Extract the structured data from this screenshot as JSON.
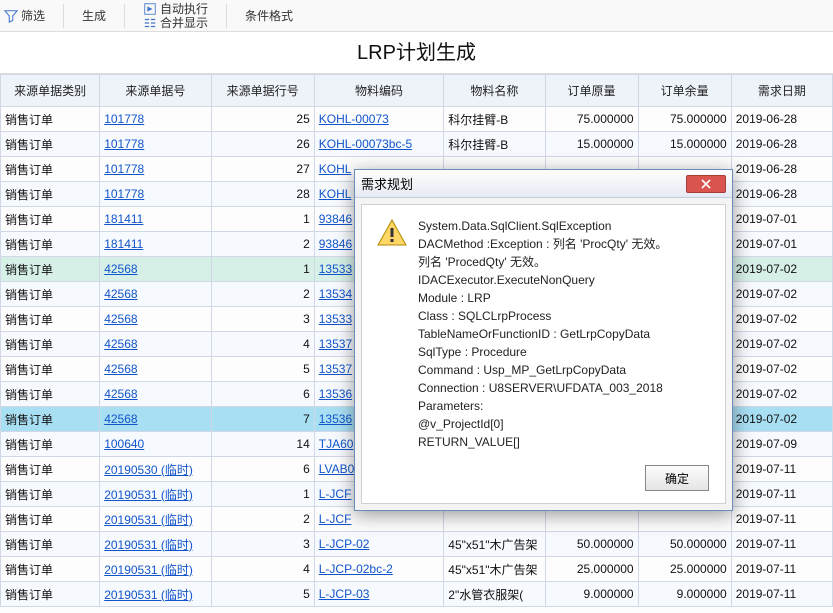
{
  "toolbar": {
    "filter": "筛选",
    "generate": "生成",
    "autorun": "自动执行",
    "merge_display": "合并显示",
    "cond_format": "条件格式"
  },
  "title": "LRP计划生成",
  "columns": [
    "来源单据类别",
    "来源单据号",
    "来源单据行号",
    "物料编码",
    "物料名称",
    "订单原量",
    "订单余量",
    "需求日期"
  ],
  "rows": [
    {
      "type": "销售订单",
      "doc": "101778",
      "ln": "25",
      "mat": "KOHL-00073",
      "name": "科尔挂臂-B",
      "oq": "75.000000",
      "rq": "75.000000",
      "dt": "2019-06-28",
      "cls": ""
    },
    {
      "type": "销售订单",
      "doc": "101778",
      "ln": "26",
      "mat": "KOHL-00073bc-5",
      "name": "科尔挂臂-B",
      "oq": "15.000000",
      "rq": "15.000000",
      "dt": "2019-06-28",
      "cls": "alt"
    },
    {
      "type": "销售订单",
      "doc": "101778",
      "ln": "27",
      "mat": "KOHL",
      "name": "",
      "oq": "",
      "rq": "",
      "dt": "2019-06-28",
      "cls": ""
    },
    {
      "type": "销售订单",
      "doc": "101778",
      "ln": "28",
      "mat": "KOHL",
      "name": "",
      "oq": "",
      "rq": "",
      "dt": "2019-06-28",
      "cls": "alt"
    },
    {
      "type": "销售订单",
      "doc": "181411",
      "ln": "1",
      "mat": "93846",
      "name": "",
      "oq": "",
      "rq": "",
      "dt": "2019-07-01",
      "cls": ""
    },
    {
      "type": "销售订单",
      "doc": "181411",
      "ln": "2",
      "mat": "93846",
      "name": "",
      "oq": "",
      "rq": "",
      "dt": "2019-07-01",
      "cls": "alt"
    },
    {
      "type": "销售订单",
      "doc": "42568",
      "ln": "1",
      "mat": "13533",
      "name": "",
      "oq": "",
      "rq": "",
      "dt": "2019-07-02",
      "cls": "hl"
    },
    {
      "type": "销售订单",
      "doc": "42568",
      "ln": "2",
      "mat": "13534",
      "name": "",
      "oq": "",
      "rq": "",
      "dt": "2019-07-02",
      "cls": "alt"
    },
    {
      "type": "销售订单",
      "doc": "42568",
      "ln": "3",
      "mat": "13533",
      "name": "",
      "oq": "",
      "rq": "",
      "dt": "2019-07-02",
      "cls": ""
    },
    {
      "type": "销售订单",
      "doc": "42568",
      "ln": "4",
      "mat": "13537",
      "name": "",
      "oq": "",
      "rq": "",
      "dt": "2019-07-02",
      "cls": "alt"
    },
    {
      "type": "销售订单",
      "doc": "42568",
      "ln": "5",
      "mat": "13537",
      "name": "",
      "oq": "",
      "rq": "",
      "dt": "2019-07-02",
      "cls": ""
    },
    {
      "type": "销售订单",
      "doc": "42568",
      "ln": "6",
      "mat": "13536",
      "name": "",
      "oq": "",
      "rq": "",
      "dt": "2019-07-02",
      "cls": "alt"
    },
    {
      "type": "销售订单",
      "doc": "42568",
      "ln": "7",
      "mat": "13536",
      "name": "",
      "oq": "",
      "rq": "",
      "dt": "2019-07-02",
      "cls": "sel"
    },
    {
      "type": "销售订单",
      "doc": "100640",
      "ln": "14",
      "mat": "TJA60",
      "name": "",
      "oq": "",
      "rq": "",
      "dt": "2019-07-09",
      "cls": "alt"
    },
    {
      "type": "销售订单",
      "doc": "20190530 (临时)",
      "ln": "6",
      "mat": "LVAB0",
      "name": "",
      "oq": "",
      "rq": "",
      "dt": "2019-07-11",
      "cls": ""
    },
    {
      "type": "销售订单",
      "doc": "20190531 (临时)",
      "ln": "1",
      "mat": "L-JCF",
      "name": "",
      "oq": "",
      "rq": "",
      "dt": "2019-07-11",
      "cls": "alt"
    },
    {
      "type": "销售订单",
      "doc": "20190531 (临时)",
      "ln": "2",
      "mat": "L-JCF",
      "name": "",
      "oq": "",
      "rq": "",
      "dt": "2019-07-11",
      "cls": ""
    },
    {
      "type": "销售订单",
      "doc": "20190531 (临时)",
      "ln": "3",
      "mat": "L-JCP-02",
      "name": "45\"x51\"木广告架",
      "oq": "50.000000",
      "rq": "50.000000",
      "dt": "2019-07-11",
      "cls": "alt"
    },
    {
      "type": "销售订单",
      "doc": "20190531 (临时)",
      "ln": "4",
      "mat": "L-JCP-02bc-2",
      "name": "45\"x51\"木广告架",
      "oq": "25.000000",
      "rq": "25.000000",
      "dt": "2019-07-11",
      "cls": ""
    },
    {
      "type": "销售订单",
      "doc": "20190531 (临时)",
      "ln": "5",
      "mat": "L-JCP-03",
      "name": "2\"水管衣服架(",
      "oq": "9.000000",
      "rq": "9.000000",
      "dt": "2019-07-11",
      "cls": "alt"
    }
  ],
  "dialog": {
    "title": "需求规划",
    "message": "System.Data.SqlClient.SqlException\nDACMethod :Exception : 列名 'ProcQty' 无效。\n列名 'ProcedQty' 无效。\n IDACExecutor.ExecuteNonQuery\nModule : LRP\nClass : SQLCLrpProcess\nTableNameOrFunctionID : GetLrpCopyData\nSqlType : Procedure\nCommand : Usp_MP_GetLrpCopyData\nConnection : U8SERVER\\UFDATA_003_2018\nParameters:\n@v_ProjectId[0]\nRETURN_VALUE[]",
    "ok": "确定"
  }
}
